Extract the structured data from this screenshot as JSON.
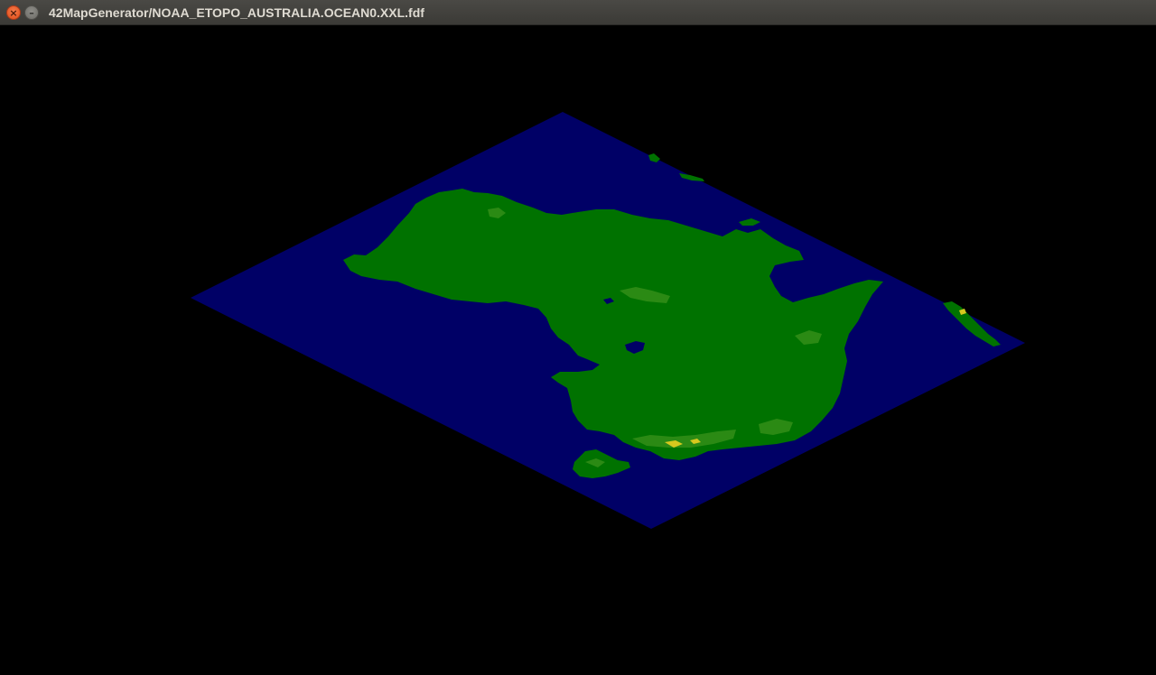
{
  "window": {
    "title": "42MapGenerator/NOAA_ETOPO_AUSTRALIA.OCEAN0.XXL.fdf",
    "close_icon": "×",
    "minimize_icon": "–"
  },
  "map": {
    "colors": {
      "background": "#000000",
      "ocean": "#000066",
      "land": "#007200",
      "highland": "#2b8a14",
      "peak": "#d6c81e"
    }
  }
}
